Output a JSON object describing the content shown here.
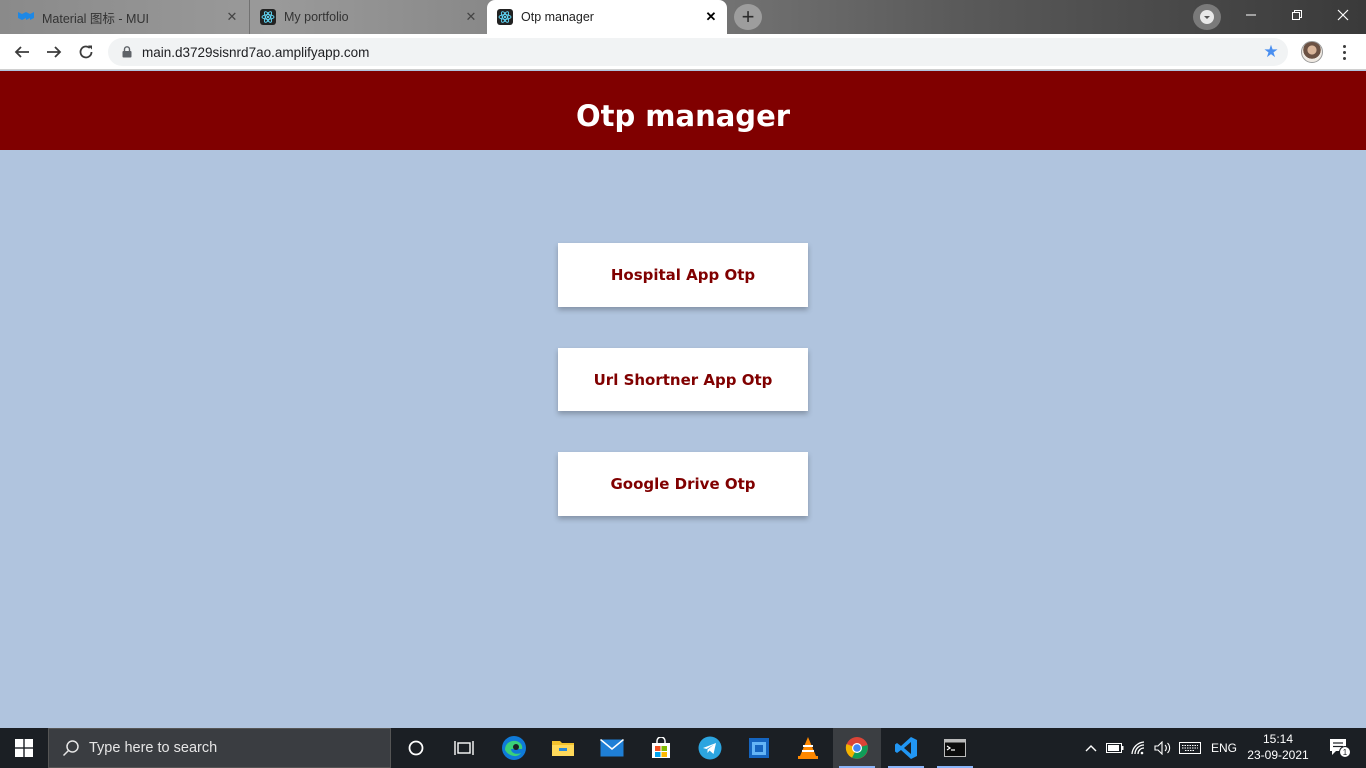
{
  "browser": {
    "tabs": [
      {
        "title": "Material 图标 - MUI",
        "icon": "mui-logo-icon"
      },
      {
        "title": "My portfolio",
        "icon": "react-logo-icon"
      },
      {
        "title": "Otp manager",
        "icon": "react-logo-icon",
        "active": true
      }
    ],
    "address_bar": {
      "url": "main.d3729sisnrd7ao.amplifyapp.com"
    }
  },
  "page": {
    "header_title": "Otp manager",
    "buttons": [
      {
        "label": "Hospital App Otp"
      },
      {
        "label": "Url Shortner App Otp"
      },
      {
        "label": "Google Drive Otp"
      }
    ],
    "colors": {
      "header_bg": "#800000",
      "page_bg": "#b0c4de",
      "button_text": "#800000"
    }
  },
  "taskbar": {
    "search_placeholder": "Type here to search",
    "language": "ENG",
    "time": "15:14",
    "date": "23-09-2021",
    "notification_count": "1"
  }
}
